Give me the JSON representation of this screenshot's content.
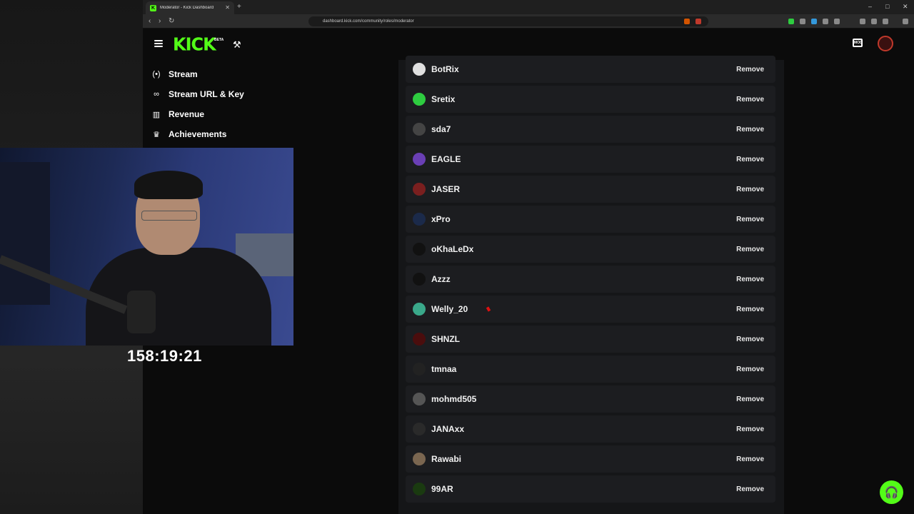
{
  "browser": {
    "tab_title": "Moderator - Kick Dashboard",
    "new_tab": "+",
    "url": "dashboard.kick.com/community/roles/moderator",
    "window_controls": [
      "–",
      "□",
      "✕"
    ]
  },
  "header": {
    "logo": "KICK",
    "beta": "BETA",
    "mod_badge": "MOD"
  },
  "sidebar": {
    "items": [
      {
        "label": "Stream",
        "icon": "stream-icon",
        "glyph": "(•)"
      },
      {
        "label": "Stream URL & Key",
        "icon": "link-icon",
        "glyph": "∞"
      },
      {
        "label": "Revenue",
        "icon": "chart-icon",
        "glyph": "▥"
      },
      {
        "label": "Achievements",
        "icon": "trophy-icon",
        "glyph": "♛"
      }
    ]
  },
  "moderators": {
    "remove_label": "Remove",
    "rows": [
      {
        "name": "BotRix",
        "color": "#e0e0e0"
      },
      {
        "name": "Sretix",
        "color": "#2ecc40"
      },
      {
        "name": "sda7",
        "color": "#444444"
      },
      {
        "name": "EAGLE",
        "color": "#6a3fb5"
      },
      {
        "name": "JASER",
        "color": "#7a1f1f"
      },
      {
        "name": "xPro",
        "color": "#1b2a4a"
      },
      {
        "name": "oKhaLeDx",
        "color": "#111111"
      },
      {
        "name": "Azzz",
        "color": "#111111"
      },
      {
        "name": "Welly_20",
        "color": "#3aa88a"
      },
      {
        "name": "SHNZL",
        "color": "#4a0d0d"
      },
      {
        "name": "tmnaa",
        "color": "#222222"
      },
      {
        "name": "mohmd505",
        "color": "#555555"
      },
      {
        "name": "JANAxx",
        "color": "#2a2a2a"
      },
      {
        "name": "Rawabi",
        "color": "#7a6650"
      },
      {
        "name": "99AR",
        "color": "#1a3a10"
      }
    ]
  },
  "overlay": {
    "timer": "158:19:21"
  },
  "colors": {
    "accent": "#53fc18",
    "panel": "#151618",
    "row": "#1c1d20"
  }
}
